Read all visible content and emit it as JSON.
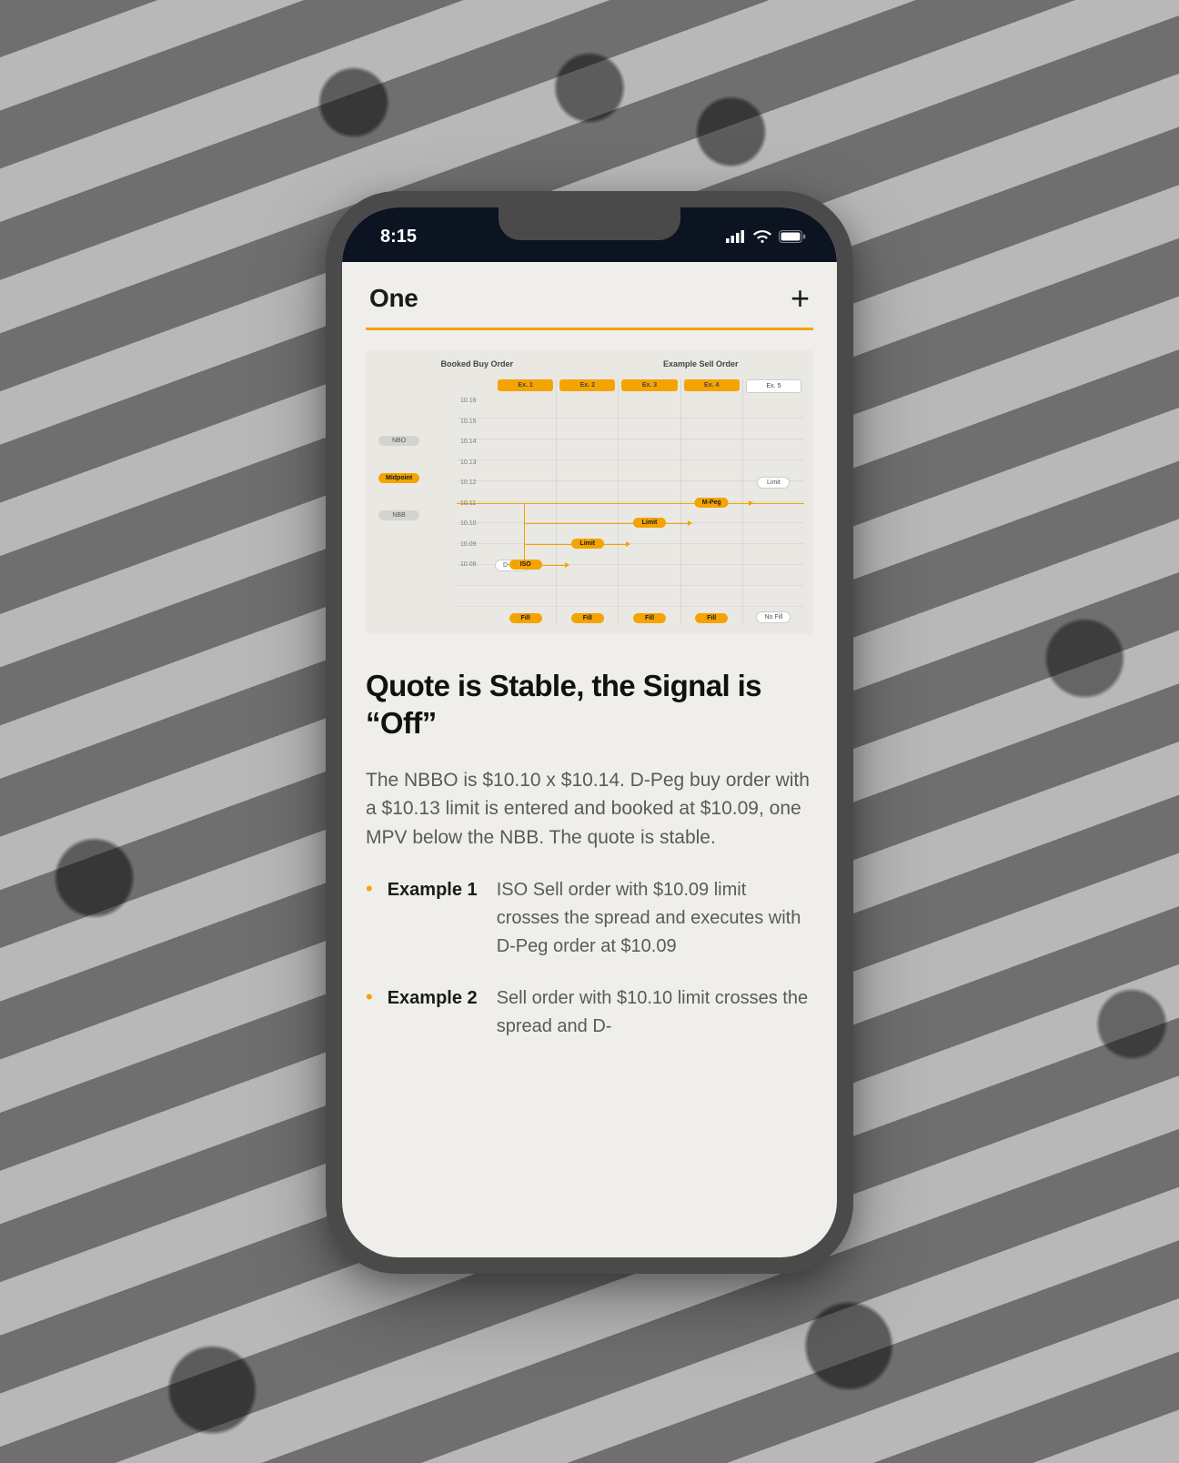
{
  "statusbar": {
    "time": "8:15"
  },
  "header": {
    "tab": "One",
    "plus_glyph": "+"
  },
  "diagram": {
    "left_header": "Booked Buy Order",
    "right_header": "Example Sell Order",
    "price_rows": [
      "10.16",
      "10.15",
      "10.14",
      "10.13",
      "10.12",
      "10.11",
      "10.10",
      "10.09",
      "10.08"
    ],
    "left_markers": {
      "nbo": "NBO",
      "midpoint": "Midpoint",
      "nbb": "NBB"
    },
    "columns": [
      "Ex. 1",
      "Ex. 2",
      "Ex. 3",
      "Ex. 4",
      "Ex. 5"
    ],
    "cells": {
      "dpeg": "D-Peg",
      "iso": "ISO",
      "limit": "Limit",
      "mpeg": "M-Peg",
      "fill": "Fill",
      "nofill": "No Fill"
    }
  },
  "article": {
    "title": "Quote is Stable, the Signal is “Off”",
    "paragraph": "The NBBO is $10.10 x $10.14. D-Peg buy order with a $10.13 limit is entered and booked at $10.09, one MPV below the NBB. The quote is stable.",
    "examples": [
      {
        "label": "Example 1",
        "body": "ISO Sell order with $10.09 limit crosses the spread and executes with D-Peg order at $10.09"
      },
      {
        "label": "Example 2",
        "body": "Sell order with $10.10 limit crosses the spread and D-"
      }
    ]
  },
  "colors": {
    "accent": "#f5a300"
  },
  "chart_data": {
    "type": "table",
    "title": "Booked Buy Order vs Example Sell Order",
    "price_levels": [
      10.16,
      10.15,
      10.14,
      10.13,
      10.12,
      10.11,
      10.1,
      10.09,
      10.08
    ],
    "nbo": 10.14,
    "midpoint": 10.12,
    "nbb": 10.1,
    "booked_dpeg_price": 10.09,
    "columns": [
      {
        "name": "Ex. 1",
        "entry": {
          "type": "ISO",
          "price": 10.09
        },
        "result": "Fill"
      },
      {
        "name": "Ex. 2",
        "entry": {
          "type": "Limit",
          "price": 10.1
        },
        "result": "Fill"
      },
      {
        "name": "Ex. 3",
        "entry": {
          "type": "Limit",
          "price": 10.11
        },
        "result": "Fill"
      },
      {
        "name": "Ex. 4",
        "entry": {
          "type": "M-Peg",
          "price": 10.12
        },
        "result": "Fill"
      },
      {
        "name": "Ex. 5",
        "entry": {
          "type": "Limit",
          "price": 10.13
        },
        "result": "No Fill"
      }
    ]
  }
}
